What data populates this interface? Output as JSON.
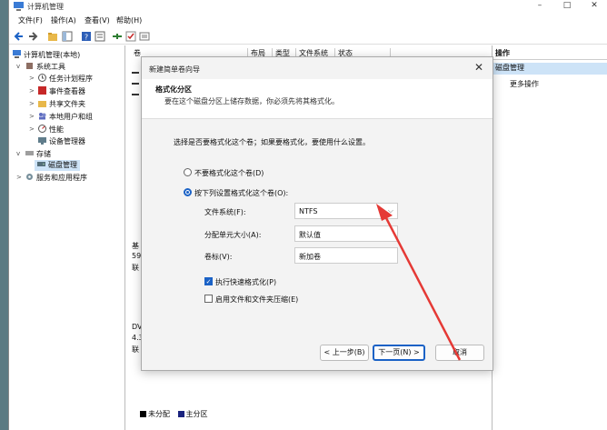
{
  "window": {
    "title": "计算机管理"
  },
  "menu": [
    "文件(F)",
    "操作(A)",
    "查看(V)",
    "帮助(H)"
  ],
  "tree": {
    "root": "计算机管理(本地)",
    "system_tools": "系统工具",
    "task_scheduler": "任务计划程序",
    "event_viewer": "事件查看器",
    "shared_folders": "共享文件夹",
    "local_users": "本地用户和组",
    "performance": "性能",
    "device_manager": "设备管理器",
    "storage": "存储",
    "disk_management": "磁盘管理",
    "services": "服务和应用程序"
  },
  "columns": [
    "卷",
    "布局",
    "类型",
    "文件系统",
    "状态"
  ],
  "disk_rows": [
    "基",
    "59",
    "联",
    "DV",
    "4.3",
    "联"
  ],
  "actions": {
    "header": "操作",
    "disk_management": "磁盘管理",
    "more": "更多操作"
  },
  "legend": {
    "unallocated": "未分配",
    "primary": "主分区"
  },
  "dialog": {
    "title": "新建简单卷向导",
    "heading": "格式化分区",
    "subheading": "要在这个磁盘分区上储存数据，你必须先将其格式化。",
    "question": "选择是否要格式化这个卷；如果要格式化，要使用什么设置。",
    "opt_no_format": "不要格式化这个卷(D)",
    "opt_format": "按下列设置格式化这个卷(O):",
    "fs_label": "文件系统(F):",
    "fs_value": "NTFS",
    "alloc_label": "分配单元大小(A):",
    "alloc_value": "默认值",
    "vol_label": "卷标(V):",
    "vol_value": "新加卷",
    "quick_format": "执行快速格式化(P)",
    "compress": "启用文件和文件夹压缩(E)",
    "back": "< 上一步(B)",
    "next": "下一页(N) >",
    "cancel": "取消"
  },
  "colors": {
    "accent": "#1b62c6",
    "selection": "#cde3f7",
    "arrow": "#e53935",
    "primary_partition": "#1a237e"
  }
}
